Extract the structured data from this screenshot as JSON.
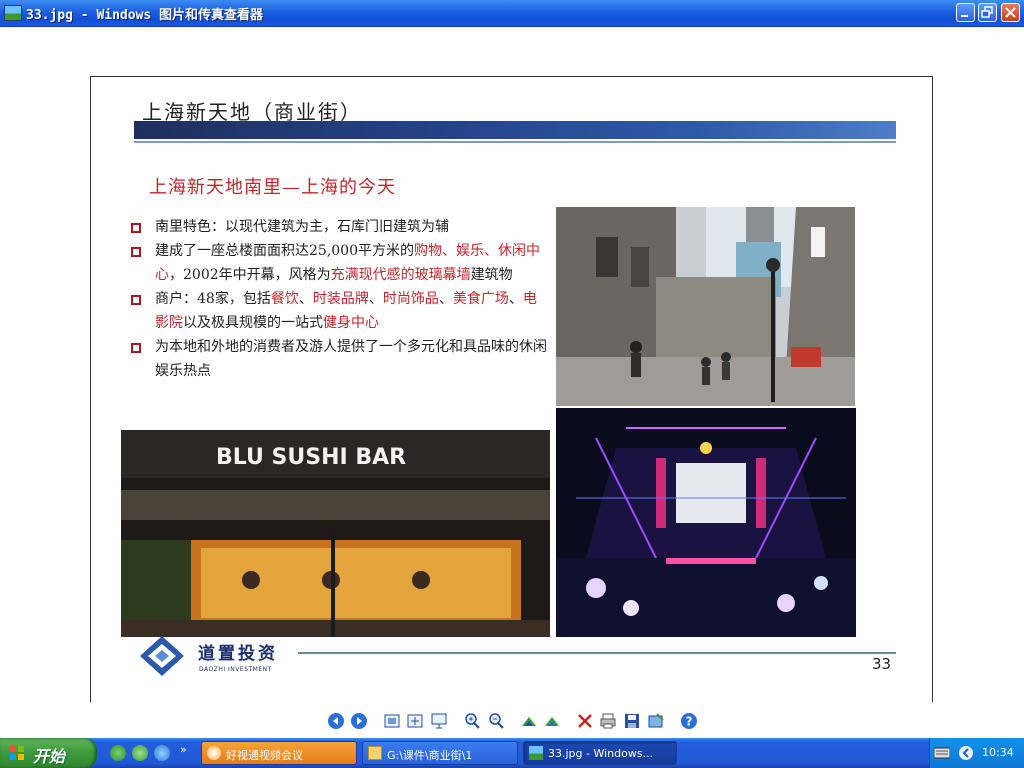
{
  "window": {
    "title": "33.jpg - Windows 图片和传真查看器",
    "buttons": [
      "minimize",
      "restore",
      "close"
    ]
  },
  "slide": {
    "title": "上海新天地（商业街）",
    "subtitle": "上海新天地南里—上海的今天",
    "bullets": [
      {
        "segments": [
          {
            "t": "南里特色：以现代建筑为主，石库门旧建筑为辅",
            "red": false
          }
        ]
      },
      {
        "segments": [
          {
            "t": "建成了一座总楼面面积达25,000平方米的",
            "red": false
          },
          {
            "t": "购物、娱乐、休闲中心",
            "red": true
          },
          {
            "t": "，2002年中开幕，风格为",
            "red": false
          },
          {
            "t": "充满现代感的玻璃幕墙",
            "red": true
          },
          {
            "t": "建筑物",
            "red": false
          }
        ]
      },
      {
        "segments": [
          {
            "t": "商户：48家，包括",
            "red": false
          },
          {
            "t": "餐饮",
            "red": true
          },
          {
            "t": "、",
            "red": false
          },
          {
            "t": "时装品牌",
            "red": true
          },
          {
            "t": "、",
            "red": false
          },
          {
            "t": "时尚饰品",
            "red": true
          },
          {
            "t": "、",
            "red": false
          },
          {
            "t": "美食广场",
            "red": true
          },
          {
            "t": "、",
            "red": false
          },
          {
            "t": "电影院",
            "red": true
          },
          {
            "t": "以及极具规模的一站式",
            "red": false
          },
          {
            "t": "健身中心",
            "red": true
          }
        ]
      },
      {
        "segments": [
          {
            "t": "为本地和外地的消费者及游人提供了一个多元化和具品味的休闲娱乐热点",
            "red": false
          }
        ]
      }
    ],
    "photo_sign": "BLU SUSHI BAR",
    "logo_cn": "道置投资",
    "logo_en": "DAOZHI INVESTMENT",
    "page_number": "33",
    "colors": {
      "accent_red": "#c0262c",
      "title_bar_blue": "#24428a"
    }
  },
  "toolbar": {
    "icons": [
      "previous-image-icon",
      "next-image-icon",
      "best-fit-icon",
      "actual-size-icon",
      "slideshow-icon",
      "zoom-in-icon",
      "zoom-out-icon",
      "rotate-clockwise-icon",
      "rotate-counterclockwise-icon",
      "delete-icon",
      "print-icon",
      "save-icon",
      "edit-icon",
      "help-icon"
    ]
  },
  "taskbar": {
    "start_label": "开始",
    "tasks": [
      {
        "label": "好视通视频会议",
        "active": false
      },
      {
        "label": "G:\\课件\\商业街\\1",
        "active": false
      },
      {
        "label": "33.jpg - Windows...",
        "active": true
      }
    ],
    "clock": "10:34"
  }
}
